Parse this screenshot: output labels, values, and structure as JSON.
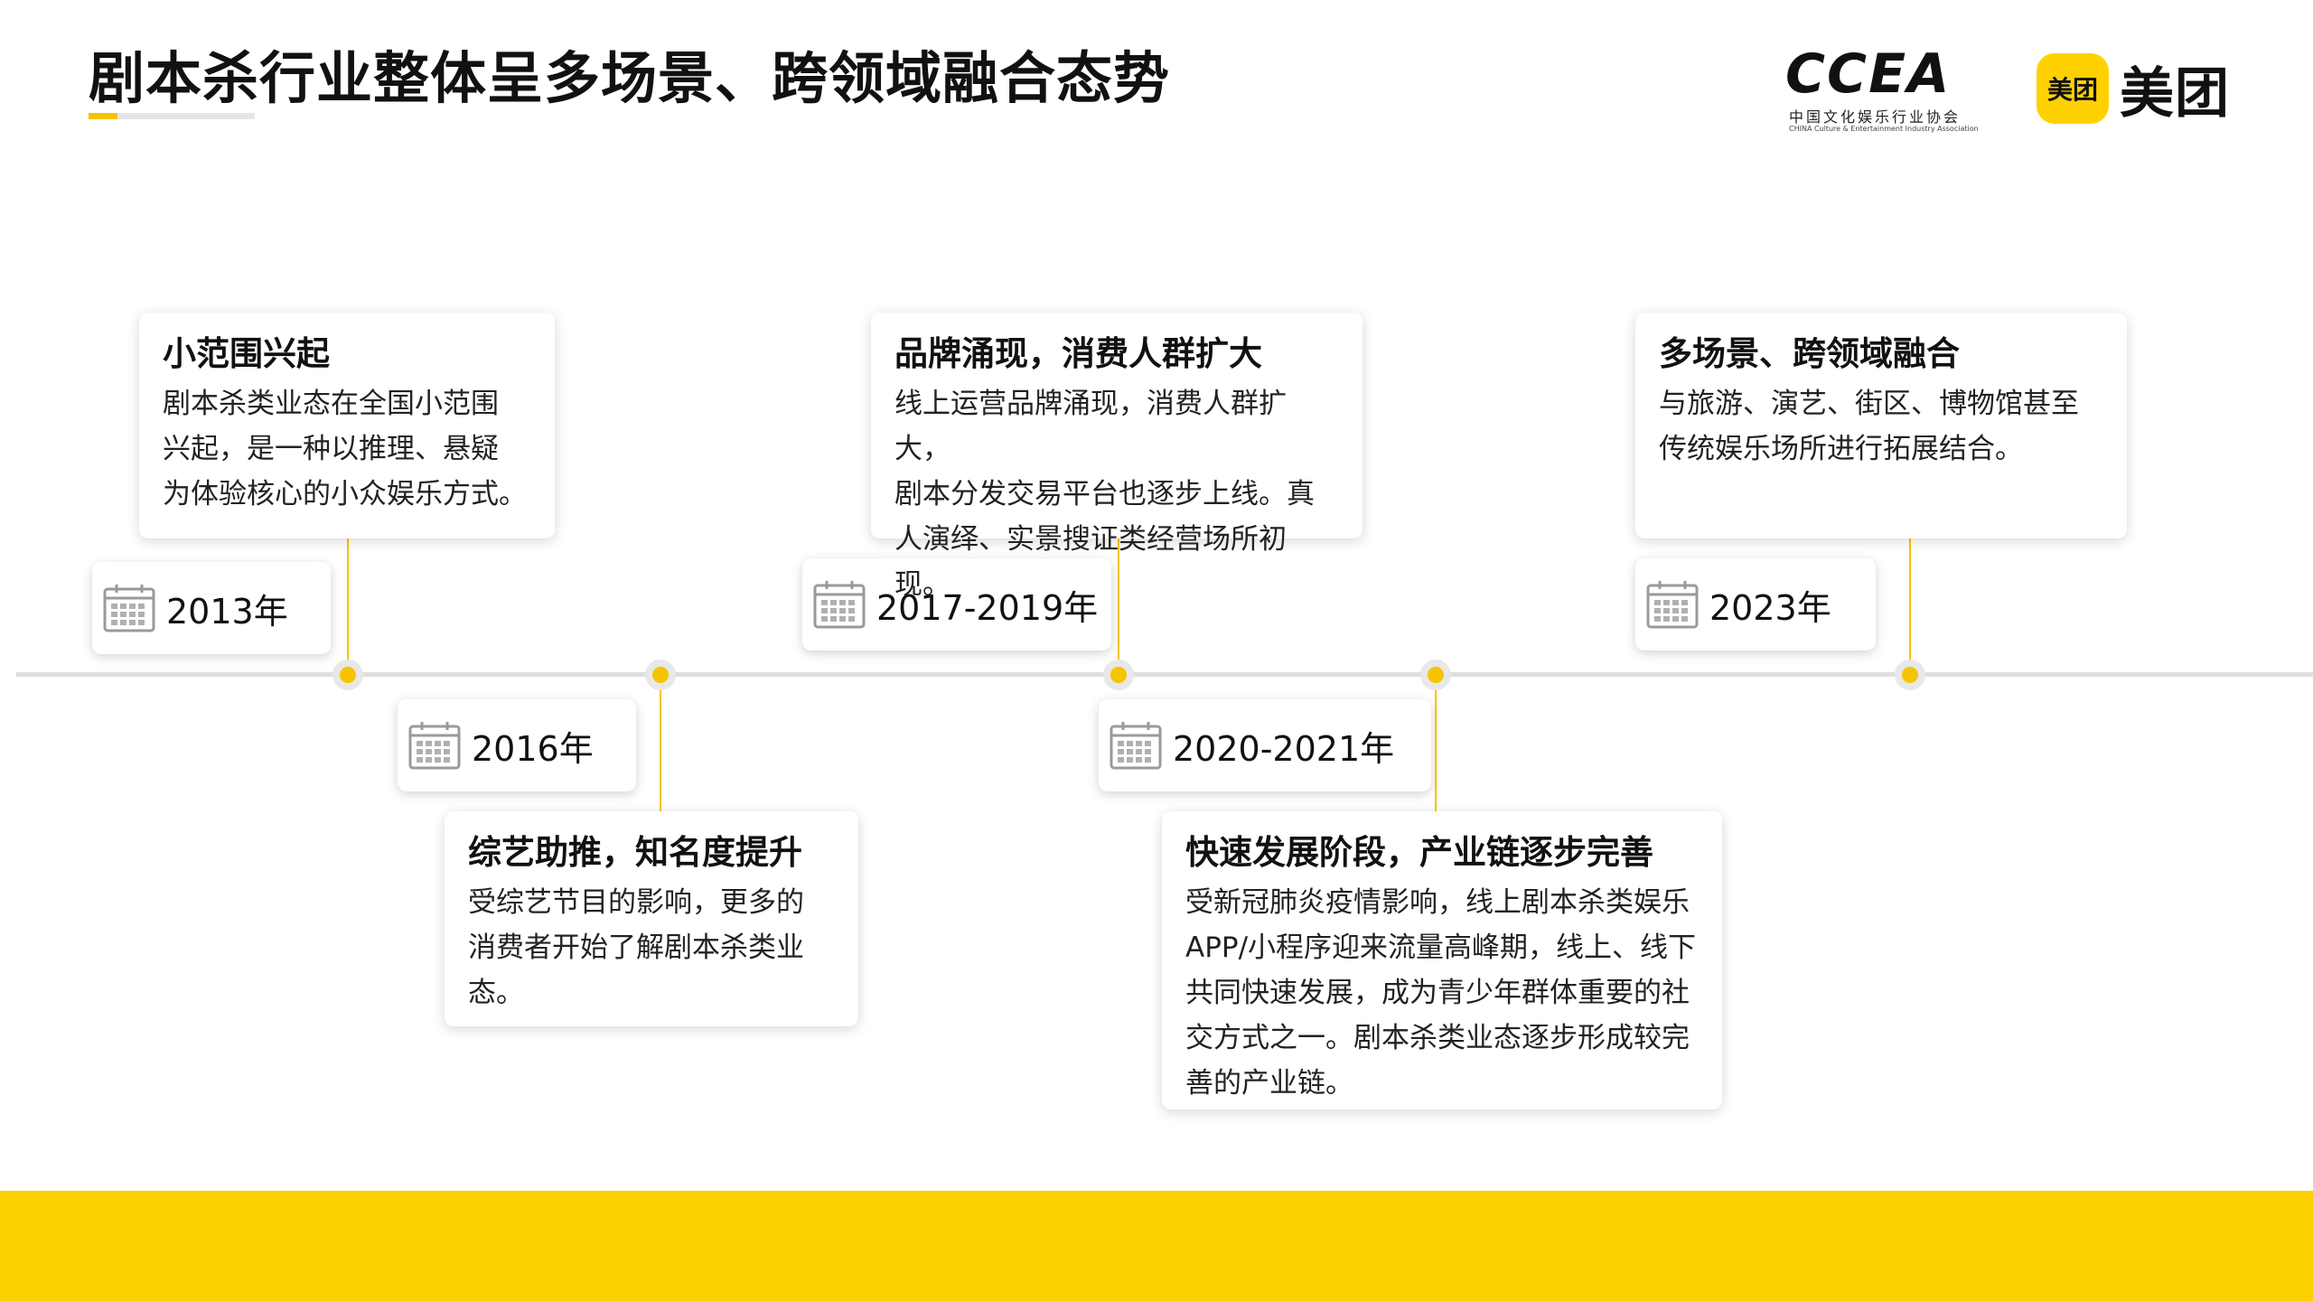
{
  "header": {
    "title": "剧本杀行业整体呈多场景、跨领域融合态势"
  },
  "logos": {
    "ccea": {
      "mark": "CCEA",
      "name_cn": "中国文化娱乐行业协会",
      "name_en": "CHINA Culture & Entertainment Industry Association"
    },
    "meituan": {
      "badge": "美团",
      "word": "美团",
      "brand_color": "#FFD100"
    }
  },
  "colors": {
    "accent": "#F5C400",
    "axis": "#DEDEDE",
    "footer": "#FDD000"
  },
  "timeline": {
    "milestones": [
      {
        "year": "2013年",
        "title": "小范围兴起",
        "lines": [
          "剧本杀类业态在全国小范围",
          "兴起，是一种以推理、悬疑",
          "为体验核心的小众娱乐方式。"
        ]
      },
      {
        "year": "2016年",
        "title": "综艺助推，知名度提升",
        "lines": [
          "受综艺节目的影响，更多的",
          "消费者开始了解剧本杀类业",
          "态。"
        ]
      },
      {
        "year": "2017-2019年",
        "title": "品牌涌现，消费人群扩大",
        "lines": [
          "线上运营品牌涌现，消费人群扩大，",
          "剧本分发交易平台也逐步上线。真",
          "人演绎、实景搜证类经营场所初现。"
        ]
      },
      {
        "year": "2020-2021年",
        "title": "快速发展阶段，产业链逐步完善",
        "lines": [
          "受新冠肺炎疫情影响，线上剧本杀类娱乐",
          "APP/小程序迎来流量高峰期，线上、线下",
          "共同快速发展，成为青少年群体重要的社",
          "交方式之一。剧本杀类业态逐步形成较完",
          "善的产业链。"
        ]
      },
      {
        "year": "2023年",
        "title": "多场景、跨领域融合",
        "lines": [
          "与旅游、演艺、街区、博物馆甚至",
          "传统娱乐场所进行拓展结合。"
        ]
      }
    ]
  }
}
